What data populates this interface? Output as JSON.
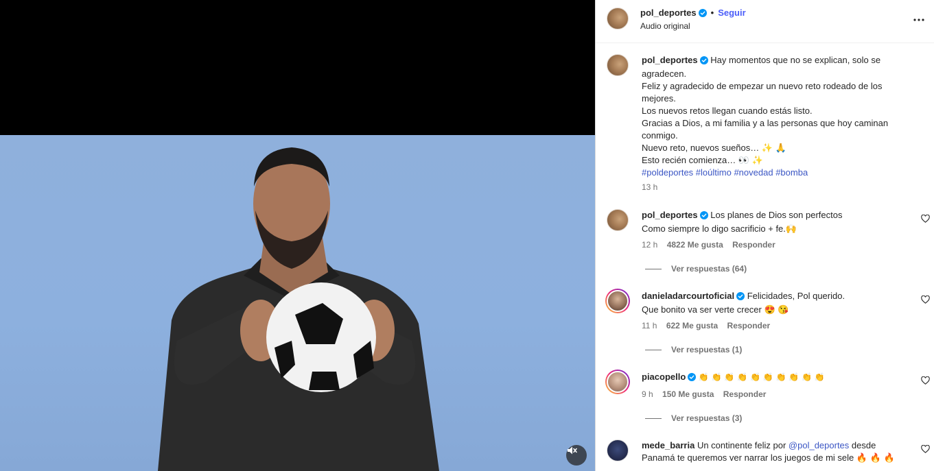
{
  "header": {
    "username": "pol_deportes",
    "follow_label": "Seguir",
    "separator": "•",
    "audio": "Audio original"
  },
  "caption": {
    "username": "pol_deportes",
    "lines": [
      "Hay momentos que no se explican, solo se",
      "agradecen.",
      "Feliz y agradecido de empezar un nuevo reto rodeado de los",
      "mejores.",
      "Los nuevos retos llegan cuando estás listo.",
      "Gracias a Dios, a mi familia y a las personas que hoy caminan",
      "conmigo.",
      "Nuevo reto, nuevos sueños… ✨ 🙏",
      "Esto recién comienza… 👀 ✨"
    ],
    "hashtags": [
      "#poldeportes",
      "#loúltimo",
      "#novedad",
      "#bomba"
    ],
    "time": "13 h"
  },
  "comments": [
    {
      "username": "pol_deportes",
      "text_lines": [
        "Los planes de Dios son perfectos",
        "Como siempre lo digo sacrificio + fe.🙌"
      ],
      "time": "12 h",
      "likes": "4822 Me gusta",
      "reply": "Responder",
      "view_replies": "Ver respuestas (64)"
    },
    {
      "username": "danieladarcourtoficial",
      "text_lines": [
        "Felicidades, Pol querido.",
        "Que bonito va ser verte crecer 😍 😘"
      ],
      "time": "11 h",
      "likes": "622 Me gusta",
      "reply": "Responder",
      "view_replies": "Ver respuestas (1)"
    },
    {
      "username": "piacopello",
      "text_lines": [
        "👏 👏 👏 👏 👏 👏 👏 👏 👏 👏"
      ],
      "time": "9 h",
      "likes": "150 Me gusta",
      "reply": "Responder",
      "view_replies": "Ver respuestas (3)"
    },
    {
      "username": "mede_barria",
      "text_prefix": "Un continente feliz por ",
      "mention": "@pol_deportes",
      "text_suffix": " desde",
      "text_line2": "Panamá te queremos ver narrar los juegos de mi sele 🔥 🔥 🔥"
    }
  ],
  "icons": {
    "verified": "verified-badge-icon",
    "more": "more-options-icon",
    "heart": "heart-outline-icon",
    "mute": "muted-speaker-icon"
  },
  "colors": {
    "accent": "#0095f6",
    "follow": "#4a5df9",
    "hashtag": "#3b56c4",
    "video_background": "#8db0de"
  }
}
